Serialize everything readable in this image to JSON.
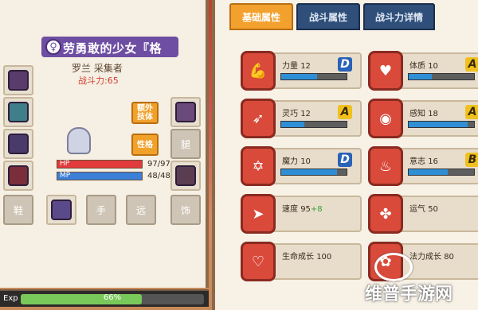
{
  "character": {
    "gender_symbol": "♀",
    "title_name": "劳勇敢的少女『格",
    "name_class": "罗兰 采集者",
    "power": "战斗力:65",
    "hp_label": "HP",
    "hp_value": "97/97",
    "hp_fraction": 1.0,
    "mp_label": "MP",
    "mp_value": "48/48",
    "mp_fraction": 1.0,
    "extra_skill_button": "额外\n技体",
    "personality_button": "性格",
    "empty_slots": [
      "鞋",
      "手",
      "远",
      "饰"
    ],
    "right_slot_label": "腿"
  },
  "exp": {
    "label": "Exp",
    "percent_text": "66%",
    "fraction": 0.66
  },
  "tabs": [
    "基础属性",
    "战斗属性",
    "战斗力详情"
  ],
  "stats": [
    {
      "label": "力量",
      "value": "12",
      "bonus": "",
      "grade": "D",
      "fraction": 0.55,
      "icon": "muscle-icon"
    },
    {
      "label": "体质",
      "value": "10",
      "bonus": "",
      "grade": "A",
      "fraction": 0.35,
      "icon": "body-icon"
    },
    {
      "label": "灵巧",
      "value": "12",
      "bonus": "",
      "grade": "A",
      "fraction": 0.35,
      "icon": "runner-icon"
    },
    {
      "label": "感知",
      "value": "18",
      "bonus": "",
      "grade": "A",
      "fraction": 0.9,
      "icon": "eye-icon"
    },
    {
      "label": "魔力",
      "value": "10",
      "bonus": "",
      "grade": "D",
      "fraction": 0.85,
      "icon": "star-icon"
    },
    {
      "label": "意志",
      "value": "16",
      "bonus": "",
      "grade": "B",
      "fraction": 0.6,
      "icon": "flame-icon"
    },
    {
      "label": "速度",
      "value": "95",
      "bonus": "+8",
      "grade": "",
      "fraction": 0,
      "icon": "speed-icon"
    },
    {
      "label": "运气",
      "value": "50",
      "bonus": "",
      "grade": "",
      "fraction": 0,
      "icon": "clover-icon"
    },
    {
      "label": "生命成长",
      "value": "100",
      "bonus": "",
      "grade": "",
      "fraction": 0,
      "icon": "heart-icon"
    },
    {
      "label": "法力成长",
      "value": "80",
      "bonus": "",
      "grade": "",
      "fraction": 0,
      "icon": "lotus-icon"
    }
  ],
  "watermark": "维普手游网",
  "colors": {
    "accent_orange": "#f2a12e",
    "tab_blue": "#2f4f7a",
    "stat_red": "#d94a3b",
    "hp_red": "#e23b3b",
    "mp_blue": "#3b7fd6",
    "exp_green": "#79c95a"
  }
}
